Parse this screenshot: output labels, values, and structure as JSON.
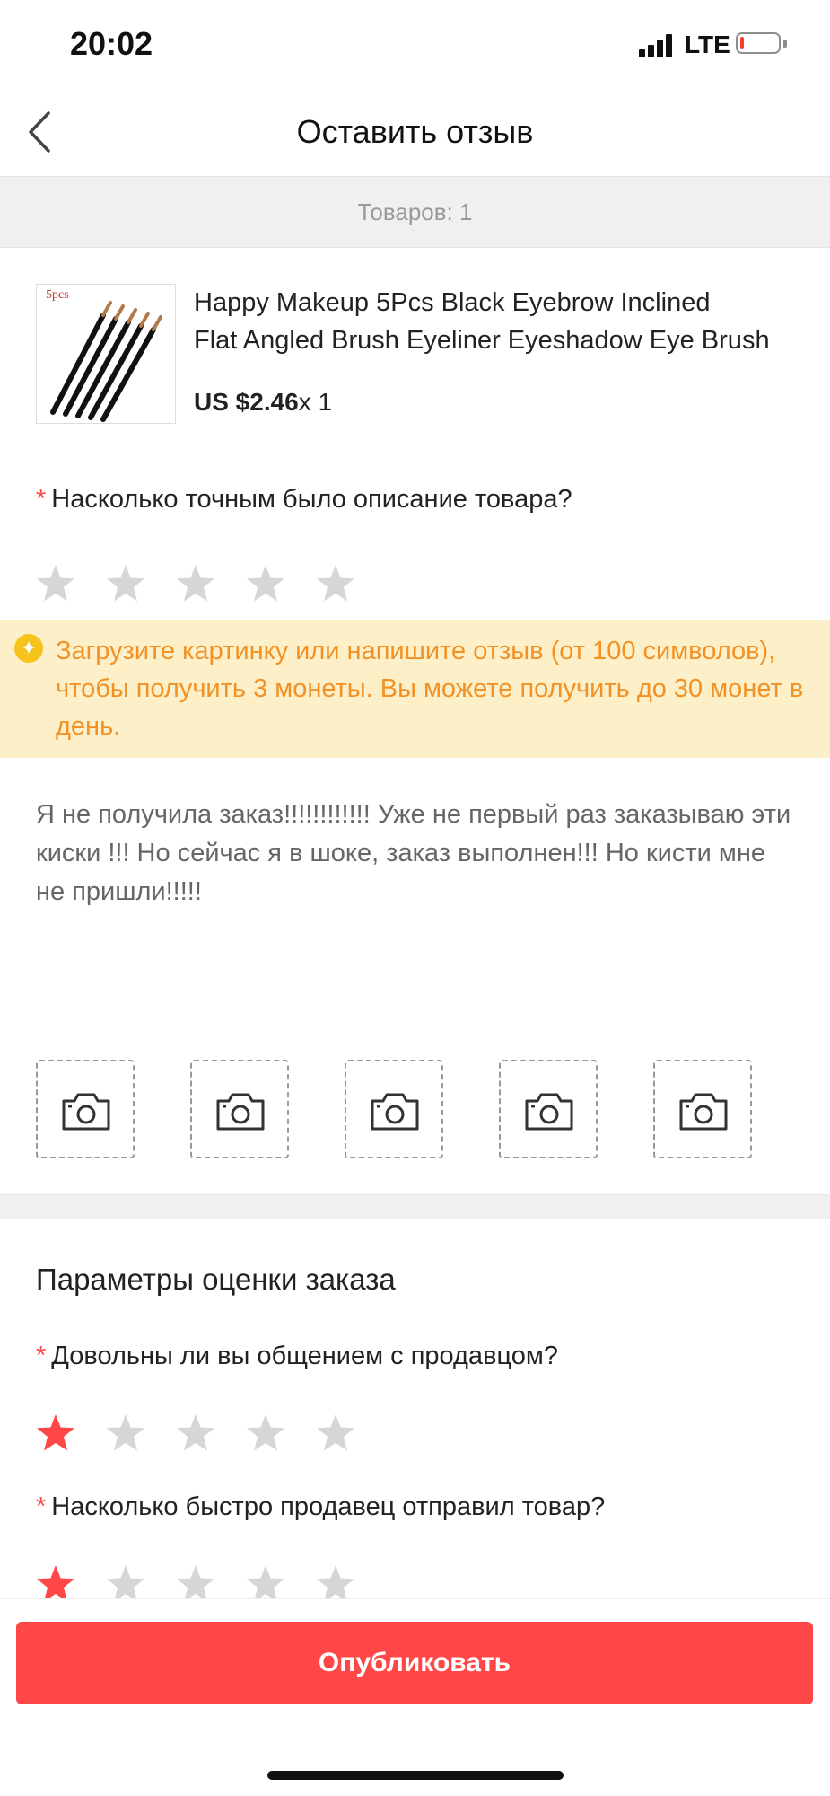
{
  "status_bar": {
    "time": "20:02",
    "network": "LTE",
    "battery_level": 0.1
  },
  "nav": {
    "title": "Оставить отзыв",
    "back_icon": "chevron-left-icon"
  },
  "items_count": "Товаров: 1",
  "product": {
    "image_tag": "5pcs",
    "title_line1": "Happy Makeup 5Pcs Black Eyebrow Inclined",
    "title_line2": "Flat Angled Brush Eyeliner Eyeshadow Eye Brush",
    "price": "US $2.46",
    "quantity": "x 1"
  },
  "rating_description": {
    "required_mark": "*",
    "question": "Насколько точным было описание товара?",
    "rating": 0,
    "max": 5
  },
  "notice": {
    "icon": "coin-icon",
    "text": "Загрузите картинку или напишите отзыв (от 100 символов), чтобы получить 3 монеты. Вы можете получить до 30 монет в день."
  },
  "review": {
    "text": "Я не получила заказ!!!!!!!!!!!! Уже не первый раз заказываю эти киски !!! Но сейчас я в шоке, заказ выполнен!!! Но кисти мне не пришли!!!!!"
  },
  "photo_slots": 5,
  "order_ratings": {
    "section_title": "Параметры оценки заказа",
    "communication": {
      "required_mark": "*",
      "question": "Довольны ли вы общением с продавцом?",
      "rating": 1,
      "max": 5
    },
    "shipping_speed": {
      "required_mark": "*",
      "question": "Насколько быстро продавец отправил товар?",
      "rating": 1,
      "max": 5
    }
  },
  "publish_button": "Опубликовать",
  "colors": {
    "accent": "#ff4747",
    "star_empty": "#d6d6d6",
    "notice_bg": "#fdf0c8",
    "notice_text": "#f29226"
  }
}
